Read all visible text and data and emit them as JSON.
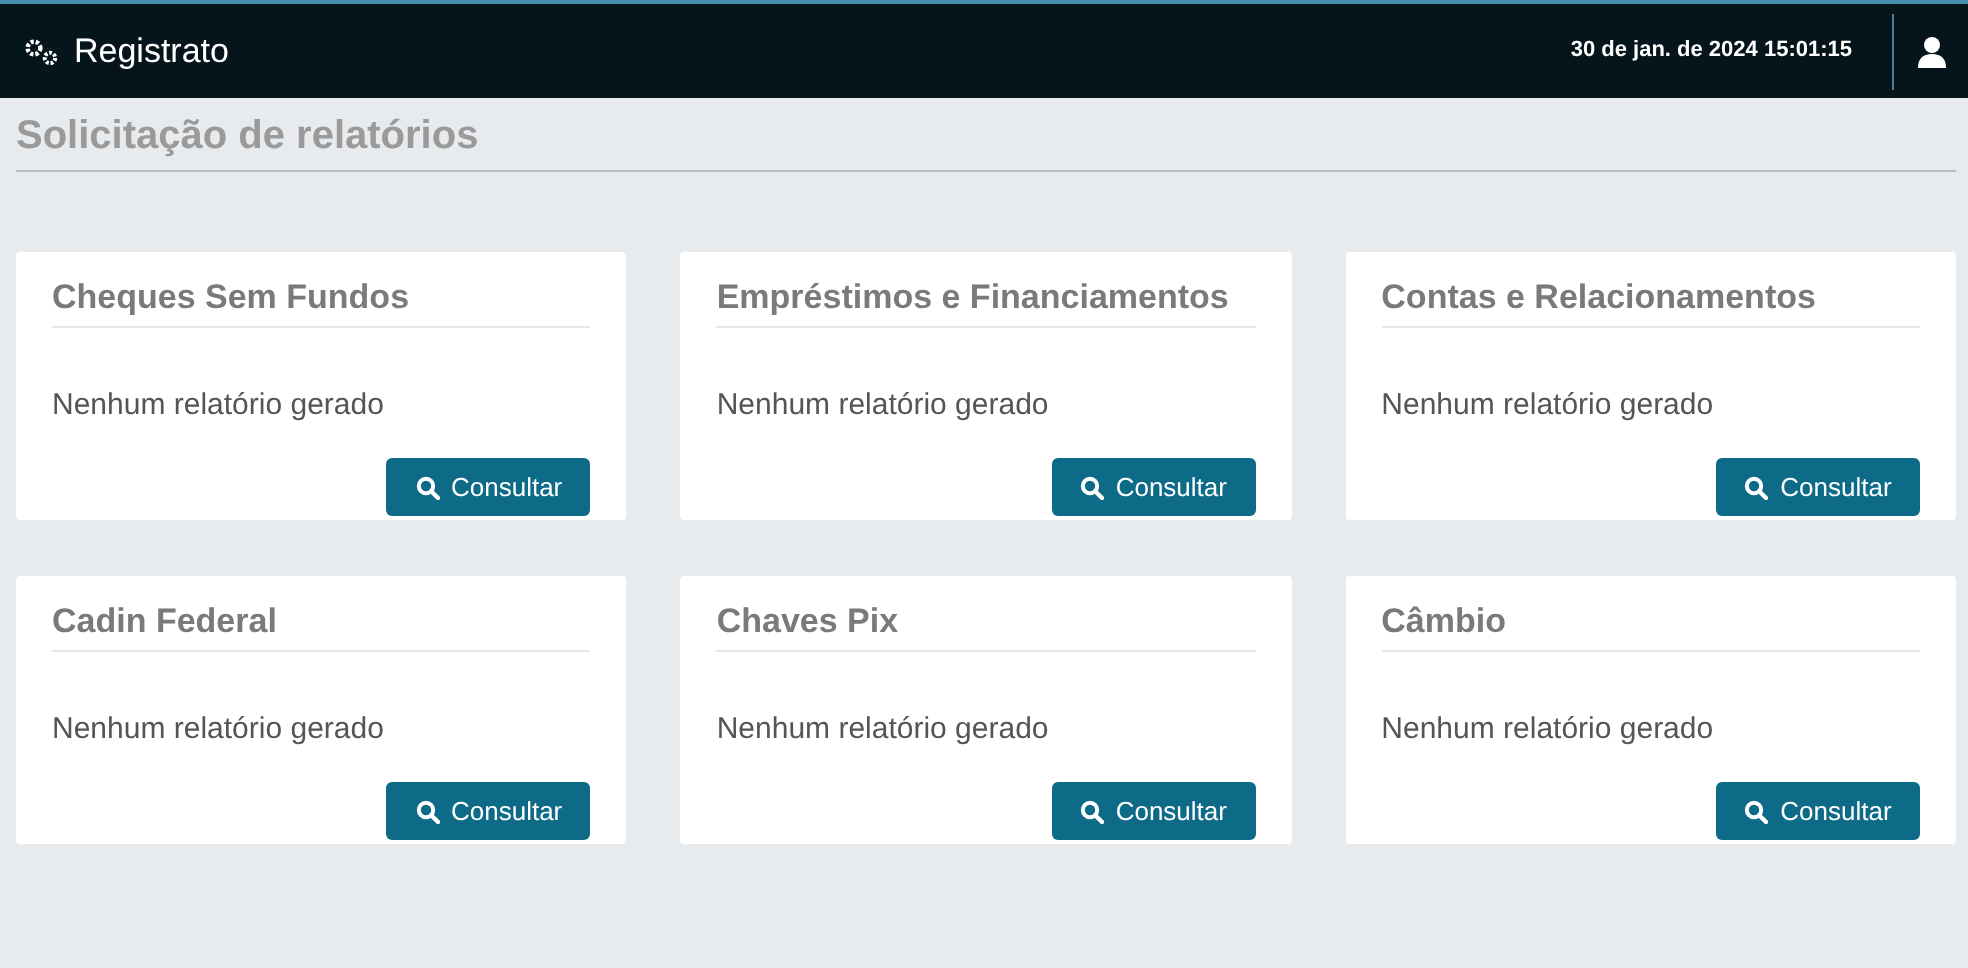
{
  "header": {
    "title": "Registrato",
    "datetime": "30 de jan. de 2024 15:01:15"
  },
  "page_title": "Solicitação de relatórios",
  "cards": [
    {
      "title": "Cheques Sem Fundos",
      "message": "Nenhum relatório gerado",
      "button": "Consultar"
    },
    {
      "title": "Empréstimos e Financiamentos",
      "message": "Nenhum relatório gerado",
      "button": "Consultar"
    },
    {
      "title": "Contas e Relacionamentos",
      "message": "Nenhum relatório gerado",
      "button": "Consultar"
    },
    {
      "title": "Cadin Federal",
      "message": "Nenhum relatório gerado",
      "button": "Consultar"
    },
    {
      "title": "Chaves Pix",
      "message": "Nenhum relatório gerado",
      "button": "Consultar"
    },
    {
      "title": "Câmbio",
      "message": "Nenhum relatório gerado",
      "button": "Consultar"
    }
  ]
}
